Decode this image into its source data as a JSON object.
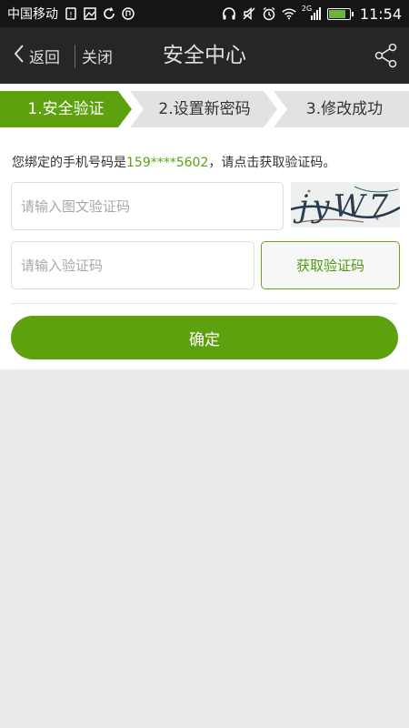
{
  "status_bar": {
    "carrier": "中国移动",
    "network": "2G",
    "time": "11:54",
    "icons_left": [
      "sim-alert-icon",
      "image-icon",
      "sync-icon",
      "music-icon"
    ],
    "icons_right": [
      "headphones-icon",
      "mute-icon",
      "alarm-icon",
      "wifi-icon",
      "signal-icon",
      "battery-icon"
    ],
    "battery_charging": true
  },
  "nav": {
    "back_label": "返回",
    "close_label": "关闭",
    "title": "安全中心",
    "share_icon": "share-icon"
  },
  "steps": [
    {
      "label": "1.安全验证",
      "active": true
    },
    {
      "label": "2.设置新密码",
      "active": false
    },
    {
      "label": "3.修改成功",
      "active": false
    }
  ],
  "form": {
    "phone_prefix": "您绑定的手机号码是",
    "phone_number": "159****5602",
    "phone_suffix": "，请点击获取验证码。",
    "captcha_placeholder": "请输入图文验证码",
    "captcha_image_text": "jyW7",
    "sms_placeholder": "请输入验证码",
    "get_code_label": "获取验证码",
    "confirm_label": "确定"
  },
  "colors": {
    "accent_green": "#5ea10e",
    "highlight_text": "#5aa312",
    "nav_bg": "#262626",
    "status_bg": "#151515",
    "page_bg": "#ebebeb",
    "step_inactive": "#e2e2e2"
  }
}
